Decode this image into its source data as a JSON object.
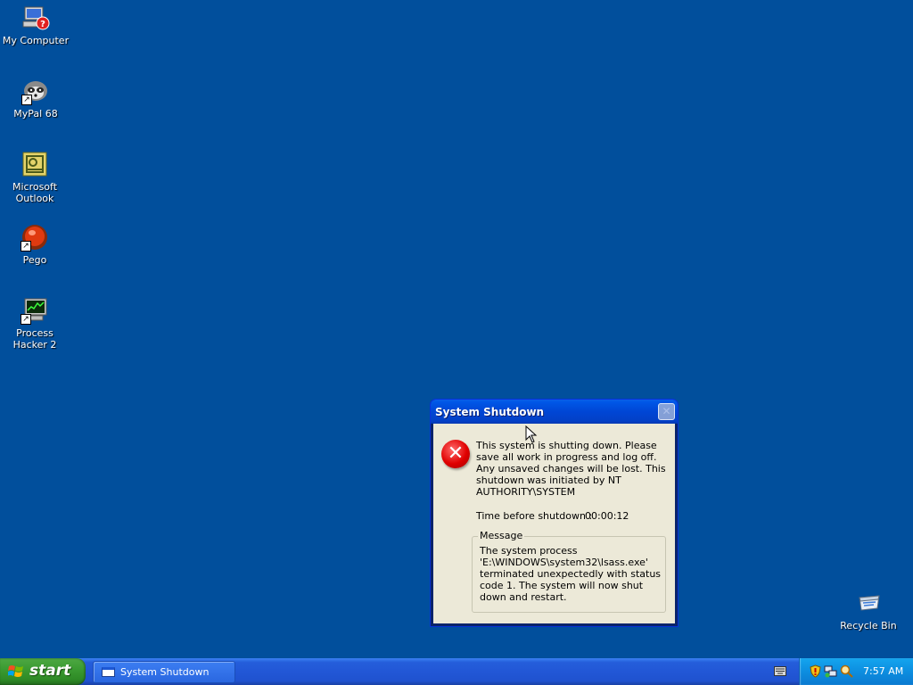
{
  "desktop": {
    "icons": [
      {
        "label": "My Computer"
      },
      {
        "label": "MyPal 68"
      },
      {
        "label": "Microsoft Outlook"
      },
      {
        "label": "Pego"
      },
      {
        "label": "Process Hacker 2"
      },
      {
        "label": "Recycle Bin"
      }
    ]
  },
  "dialog": {
    "title": "System Shutdown",
    "close_label": "✕",
    "message": "This system is shutting down. Please save all work in progress and log off. Any unsaved changes will be lost. This shutdown was initiated by NT AUTHORITY\\SYSTEM",
    "time_label": "Time before shutdown :",
    "time_value": "00:00:12",
    "group_label": "Message",
    "group_text": "The system process 'E:\\WINDOWS\\system32\\lsass.exe' terminated unexpectedly with status code 1.  The system will now shut down and restart."
  },
  "taskbar": {
    "start_label": "start",
    "task_label": "System Shutdown",
    "clock": "7:57 AM"
  },
  "colors": {
    "desktop": "#014f9c",
    "title_bar": "#0046d5",
    "dialog_bg": "#ece9d8",
    "start_green": "#3b9b32",
    "tray_blue": "#0d8ee0"
  }
}
